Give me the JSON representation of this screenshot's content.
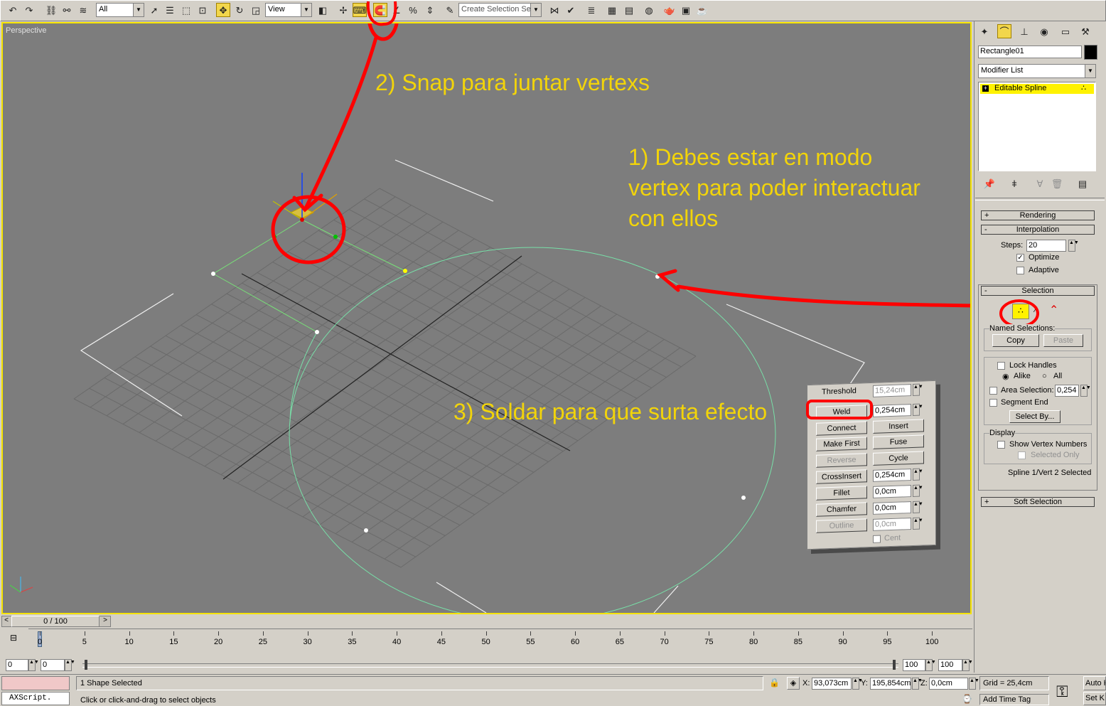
{
  "toolbar": {
    "selection_filter": "All",
    "ref_coord": "View",
    "named_selection_placeholder": "Create Selection Set"
  },
  "viewport": {
    "label": "Perspective",
    "annotation_1_line1": "1) Debes estar en modo",
    "annotation_1_line2": "vertex para poder interactuar",
    "annotation_1_line3": "con ellos",
    "annotation_2": "2) Snap para juntar vertexs",
    "annotation_3": "3) Soldar para que surta efecto"
  },
  "overlay_panel": {
    "threshold_label": "Threshold",
    "threshold_value": "15,24cm",
    "weld_label": "Weld",
    "weld_value": "0,254cm",
    "connect": "Connect",
    "insert": "Insert",
    "make_first": "Make First",
    "fuse": "Fuse",
    "reverse": "Reverse",
    "cycle": "Cycle",
    "crossinsert": "CrossInsert",
    "crossinsert_value": "0,254cm",
    "fillet": "Fillet",
    "fillet_value": "0,0cm",
    "chamfer": "Chamfer",
    "chamfer_value": "0,0cm",
    "outline": "Outline",
    "outline_value": "0,0cm",
    "center": "Cent"
  },
  "command_panel": {
    "object_name": "Rectangle01",
    "modifier_list": "Modifier List",
    "stack_item": "Editable Spline",
    "rendering": "Rendering",
    "interpolation": "Interpolation",
    "steps_label": "Steps:",
    "steps_value": "20",
    "optimize": "Optimize",
    "adaptive": "Adaptive",
    "selection": "Selection",
    "named_selections": "Named Selections:",
    "copy": "Copy",
    "paste": "Paste",
    "lock_handles": "Lock Handles",
    "alike": "Alike",
    "all": "All",
    "area_selection": "Area Selection:",
    "area_value": "0,254",
    "segment_end": "Segment End",
    "select_by": "Select By...",
    "display": "Display",
    "show_vertex_numbers": "Show Vertex Numbers",
    "selected_only": "Selected Only",
    "selection_status": "Spline 1/Vert 2 Selected",
    "soft_selection": "Soft Selection"
  },
  "timeline": {
    "frame_display": "0 / 100",
    "ticks": [
      "0",
      "5",
      "10",
      "15",
      "20",
      "25",
      "30",
      "35",
      "40",
      "45",
      "50",
      "55",
      "60",
      "65",
      "70",
      "75",
      "80",
      "85",
      "90",
      "95",
      "100"
    ],
    "start_a": "0",
    "start_b": "0",
    "end_a": "100",
    "end_b": "100"
  },
  "status": {
    "maxscript": "AXScript.",
    "selection_info": "1 Shape Selected",
    "prompt": "Click or click-and-drag to select objects",
    "x_label": "X:",
    "x_value": "93,073cm",
    "y_label": "Y:",
    "y_value": "195,854cm",
    "z_label": "Z:",
    "z_value": "0,0cm",
    "grid": "Grid = 25,4cm",
    "add_time_tag": "Add Time Tag",
    "auto": "Auto K",
    "set": "Set K"
  }
}
